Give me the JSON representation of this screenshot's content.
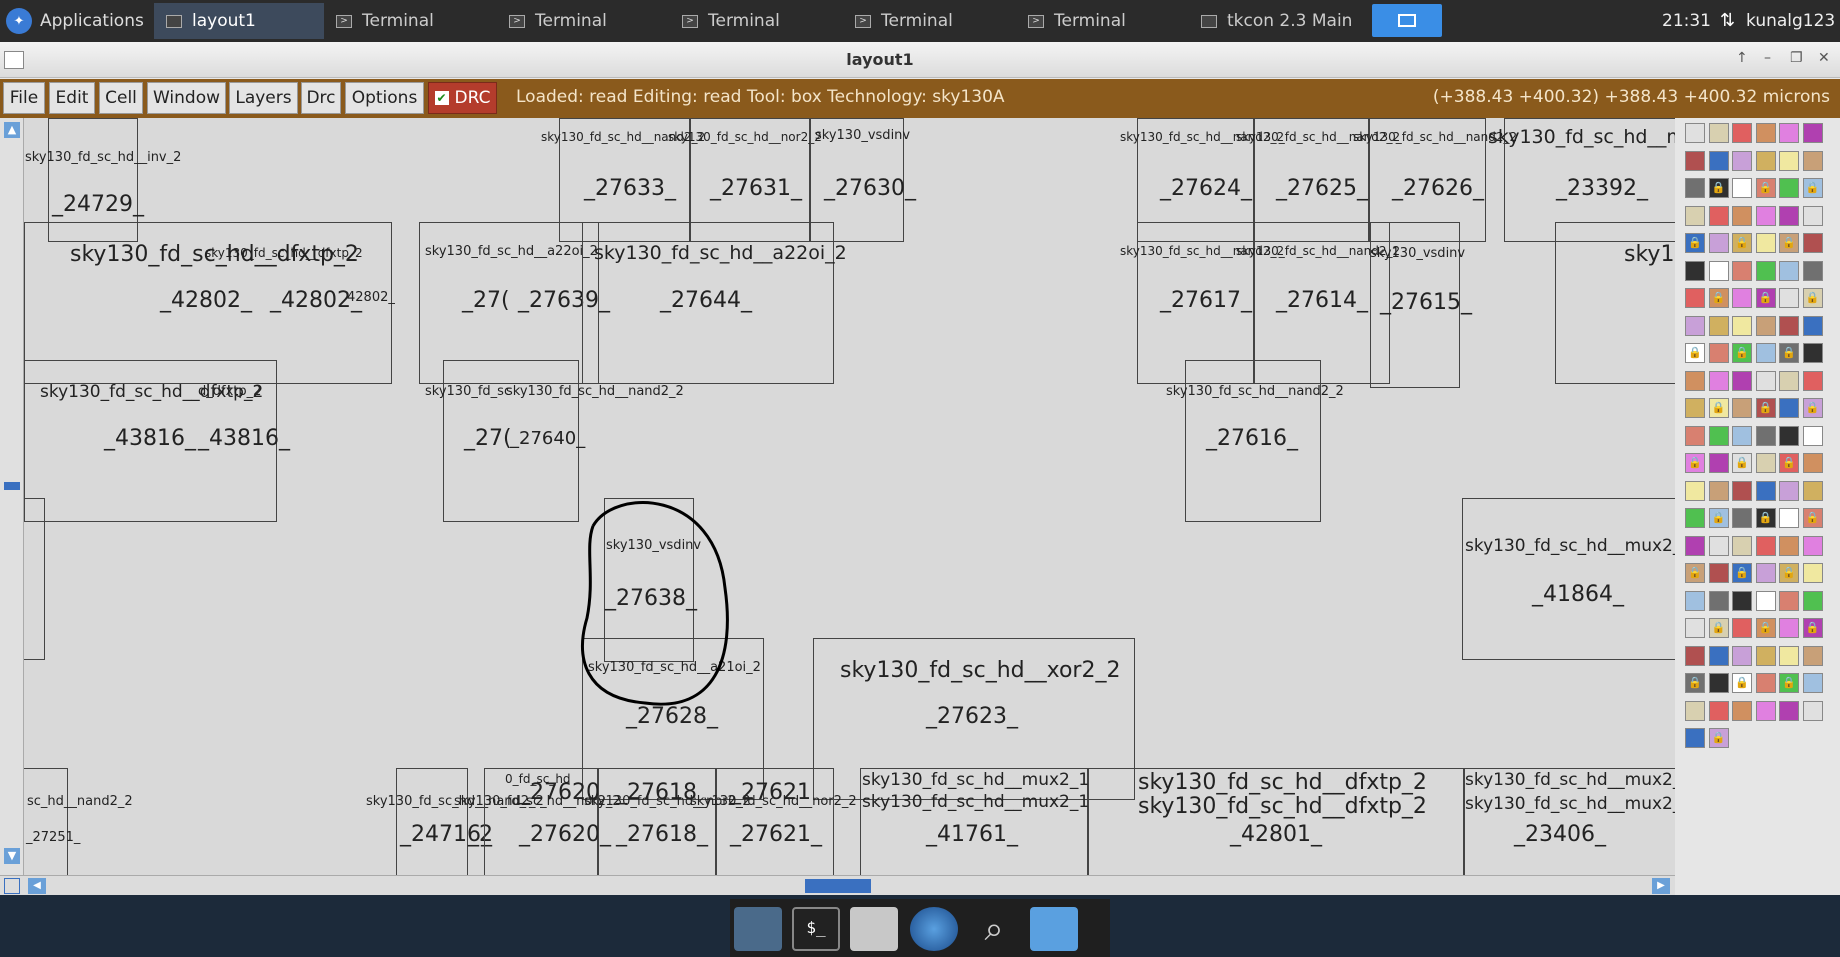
{
  "taskbar": {
    "apps_label": "Applications",
    "tasks": [
      {
        "label": "layout1",
        "active": true
      },
      {
        "label": "Terminal"
      },
      {
        "label": "Terminal"
      },
      {
        "label": "Terminal"
      },
      {
        "label": "Terminal"
      },
      {
        "label": "Terminal"
      },
      {
        "label": "tkcon 2.3 Main"
      }
    ],
    "clock": "21:31",
    "user": "kunalg123"
  },
  "window": {
    "title": "layout1"
  },
  "menu": {
    "items": [
      "File",
      "Edit",
      "Cell",
      "Window",
      "Layers",
      "Drc",
      "Options"
    ],
    "drc_label": "DRC",
    "drc_checked": true
  },
  "status": {
    "text": "Loaded: read Editing: read Tool: box  Technology: sky130A",
    "coords": "(+388.43 +400.32) +388.43 +400.32 microns"
  },
  "cells": [
    {
      "id": "_24729_",
      "type": "sky130_fd_sc_hd__inv_2"
    },
    {
      "id": "_27633_",
      "type": "sky130_fd_sc_hd__nand2_2"
    },
    {
      "id": "_27631_",
      "type": "sky130_fd_sc_hd__nor2_2"
    },
    {
      "id": "_27630_",
      "type": "sky130_vsdinv"
    },
    {
      "id": "_27624_",
      "type": "sky130_fd_sc_hd__nand2_2"
    },
    {
      "id": "_27625_",
      "type": "sky130_fd_sc_hd__nand2_2"
    },
    {
      "id": "_27626_",
      "type": "sky130_fd_sc_hd__nand2_2"
    },
    {
      "id": "_23392_",
      "type": "sky130_fd_sc_hd__mux2_1"
    },
    {
      "id": "_42802_",
      "type": "sky130_fd_sc_hd__dfxtp_2"
    },
    {
      "id": "_27639_",
      "type": "sky130_fd_sc_hd__a22oi_2"
    },
    {
      "id": "_27644_",
      "type": "sky130_fd_sc_hd__a22oi_2"
    },
    {
      "id": "_27617_",
      "type": "sky130_fd_sc_hd__nand2_2"
    },
    {
      "id": "_27614_",
      "type": "sky130_fd_sc_hd__nand2_2"
    },
    {
      "id": "_27615_",
      "type": "sky130_vsdinv"
    },
    {
      "id": "_43816_",
      "type": "sky130_fd_sc_hd__dfxtp_2"
    },
    {
      "id": "_27640_",
      "type": "sky130_fd_sc_hd__nand2_2"
    },
    {
      "id": "_27616_",
      "type": "sky130_fd_sc_hd__nand2_2"
    },
    {
      "id": "_27638_",
      "type": "sky130_vsdinv"
    },
    {
      "id": "_41864_",
      "type": "sky130_fd_sc_hd__mux2_1"
    },
    {
      "id": "_27628_",
      "type": "sky130_fd_sc_hd__a21oi_2"
    },
    {
      "id": "_27623_",
      "type": "sky130_fd_sc_hd__xor2_2"
    },
    {
      "id": "_27620_",
      "type": "sky130_fd_sc_hd__nor2_2"
    },
    {
      "id": "_27618_",
      "type": "sky130_fd_sc_hd__nor2_2"
    },
    {
      "id": "_27621_",
      "type": "sky130_fd_sc_hd__nor2_2"
    },
    {
      "id": "_24716_",
      "type": "sky130_fd_sc_hd__nand2_2"
    },
    {
      "id": "_41761_",
      "type": "sky130_fd_sc_hd__mux2_1"
    },
    {
      "id": "_42801_",
      "type": "sky130_fd_sc_hd__dfxtp_2"
    },
    {
      "id": "_23406_",
      "type": "sky130_fd_sc_hd__mux2_1"
    },
    {
      "id": "_27251_",
      "type": "sc_hd__nand2_2"
    }
  ],
  "labels": {
    "sky13_cut": "sky13",
    "label_42802_small": "42802_",
    "frag_27": "_27(",
    "frag_27b": "_27(",
    "frag_dfxtp_overlay": "dfxtp_2",
    "frag_sd": "sky130_fd_sc",
    "frag_41761b": "sky130_fd_sc_hd__mux2_1",
    "frag_42801b": "sky130_fd_sc_hd__dfxtp_2",
    "frag_23406b": "sky130_fd_sc_hd__mux2_",
    "frag_0": "0_fd_sc_hd",
    "frag_dfxtp_mid": "sky130_fd_sc_hd__dfxtp_2",
    "frag_dfxtp_right": "d_dfxtp_2",
    "frag_nand2_row2": "sky130_fd_sc_hd__nand2_2",
    "frag_27620": "_27620",
    "frag_27618": "_27618",
    "frag_27621": "_27621",
    "frag_2": "_2"
  },
  "annotation": {
    "shape": "hand-drawn circle around _27638_"
  },
  "palette": {
    "rows": 23,
    "cols": 6
  },
  "dock": {
    "items": [
      "desktop-icon",
      "terminal-icon",
      "home-folder-icon",
      "browser-icon",
      "search-icon",
      "files-icon"
    ]
  }
}
